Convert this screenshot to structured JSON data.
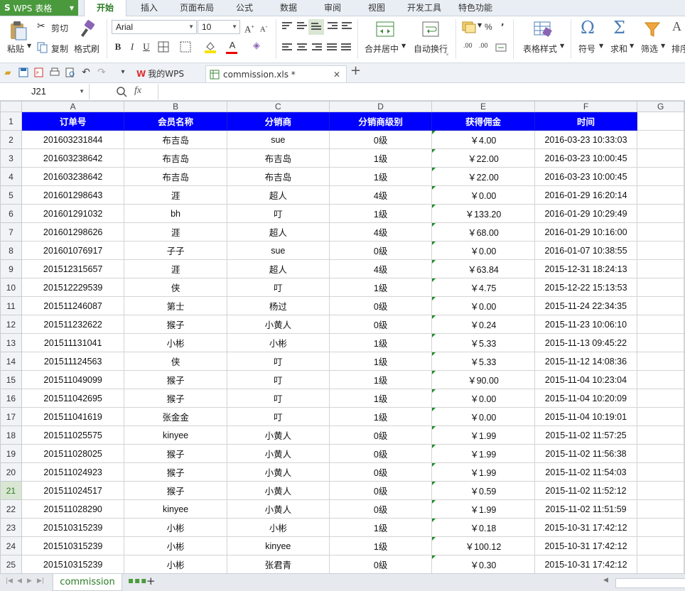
{
  "app": {
    "name": "WPS 表格"
  },
  "menu": [
    "开始",
    "插入",
    "页面布局",
    "公式",
    "数据",
    "审阅",
    "视图",
    "开发工具",
    "特色功能"
  ],
  "ribbon": {
    "paste": "粘贴",
    "cut": "剪切",
    "copy": "复制",
    "format_painter": "格式刷",
    "font_name": "Arial",
    "font_size": "10",
    "merge_center": "合并居中",
    "wrap_text": "自动换行",
    "table_style": "表格样式",
    "symbol": "符号",
    "sum": "求和",
    "filter": "筛选",
    "sort": "排序",
    "bold": "B",
    "italic": "I",
    "underline": "U",
    "percent": "%",
    "comma": "’",
    "dec_inc": ".00",
    "dec_dec": ".00"
  },
  "tabs": {
    "my_wps": "我的WPS",
    "file": "commission.xls *"
  },
  "formula_bar": {
    "name_box": "J21",
    "fx": "fx",
    "value": ""
  },
  "sheet": {
    "columns": [
      "A",
      "B",
      "C",
      "D",
      "E",
      "F",
      "G"
    ],
    "headers": [
      "订单号",
      "会员名称",
      "分销商",
      "分销商级别",
      "获得佣金",
      "时间"
    ],
    "selected_row": 21,
    "rows": [
      [
        "201603231844",
        "布吉岛",
        "sue",
        "0级",
        "￥4.00",
        "2016-03-23 10:33:03"
      ],
      [
        "201603238642",
        "布吉岛",
        "布吉岛",
        "1级",
        "￥22.00",
        "2016-03-23 10:00:45"
      ],
      [
        "201603238642",
        "布吉岛",
        "布吉岛",
        "1级",
        "￥22.00",
        "2016-03-23 10:00:45"
      ],
      [
        "201601298643",
        "涯",
        "超人",
        "4级",
        "￥0.00",
        "2016-01-29 16:20:14"
      ],
      [
        "201601291032",
        "bh",
        "叮",
        "1级",
        "￥133.20",
        "2016-01-29 10:29:49"
      ],
      [
        "201601298626",
        "涯",
        "超人",
        "4级",
        "￥68.00",
        "2016-01-29 10:16:00"
      ],
      [
        "201601076917",
        "子子",
        "sue",
        "0级",
        "￥0.00",
        "2016-01-07 10:38:55"
      ],
      [
        "201512315657",
        "涯",
        "超人",
        "4级",
        "￥63.84",
        "2015-12-31 18:24:13"
      ],
      [
        "201512229539",
        "侠",
        "叮",
        "1级",
        "￥4.75",
        "2015-12-22 15:13:53"
      ],
      [
        "201511246087",
        "第士",
        "杨过",
        "0级",
        "￥0.00",
        "2015-11-24 22:34:35"
      ],
      [
        "201511232622",
        "猴子",
        "小黄人",
        "0级",
        "￥0.24",
        "2015-11-23 10:06:10"
      ],
      [
        "201511131041",
        "小彬",
        "小彬",
        "1级",
        "￥5.33",
        "2015-11-13 09:45:22"
      ],
      [
        "201511124563",
        "侠",
        "叮",
        "1级",
        "￥5.33",
        "2015-11-12 14:08:36"
      ],
      [
        "201511049099",
        "猴子",
        "叮",
        "1级",
        "￥90.00",
        "2015-11-04 10:23:04"
      ],
      [
        "201511042695",
        "猴子",
        "叮",
        "1级",
        "￥0.00",
        "2015-11-04 10:20:09"
      ],
      [
        "201511041619",
        "张金金",
        "叮",
        "1级",
        "￥0.00",
        "2015-11-04 10:19:01"
      ],
      [
        "201511025575",
        "kinyee",
        "小黄人",
        "0级",
        "￥1.99",
        "2015-11-02 11:57:25"
      ],
      [
        "201511028025",
        "猴子",
        "小黄人",
        "0级",
        "￥1.99",
        "2015-11-02 11:56:38"
      ],
      [
        "201511024923",
        "猴子",
        "小黄人",
        "0级",
        "￥1.99",
        "2015-11-02 11:54:03"
      ],
      [
        "201511024517",
        "猴子",
        "小黄人",
        "0级",
        "￥0.59",
        "2015-11-02 11:52:12"
      ],
      [
        "201511028290",
        "kinyee",
        "小黄人",
        "0级",
        "￥1.99",
        "2015-11-02 11:51:59"
      ],
      [
        "201510315239",
        "小彬",
        "小彬",
        "1级",
        "￥0.18",
        "2015-10-31 17:42:12"
      ],
      [
        "201510315239",
        "小彬",
        "kinyee",
        "1级",
        "￥100.12",
        "2015-10-31 17:42:12"
      ],
      [
        "201510315239",
        "小彬",
        "张君青",
        "0级",
        "￥0.30",
        "2015-10-31 17:42:12"
      ]
    ]
  },
  "sheet_tabs": {
    "active": "commission",
    "add": "+"
  },
  "colors": {
    "header_fill": "#0000ff",
    "header_text": "#ffffff",
    "brand_green": "#4a9a3d"
  }
}
